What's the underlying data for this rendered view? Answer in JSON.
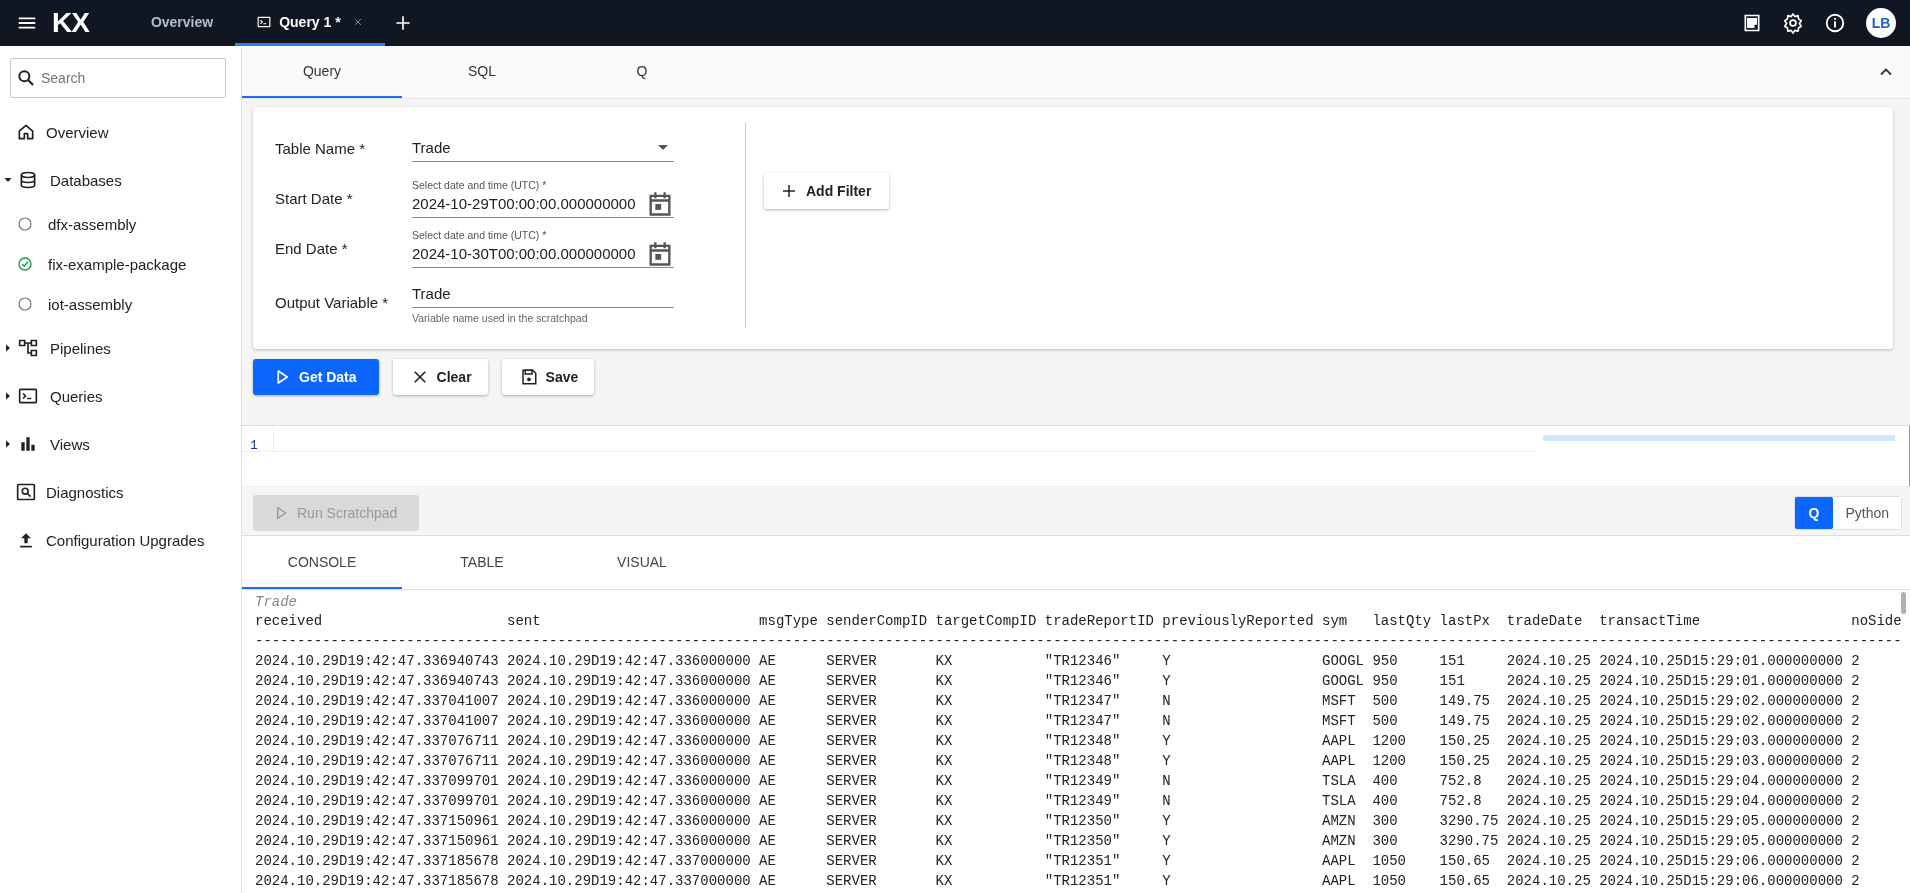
{
  "header": {
    "logo": "KX",
    "tabs": [
      {
        "label": "Overview",
        "selected": false
      },
      {
        "label": "Query 1 *",
        "selected": true
      }
    ],
    "avatar": "LB"
  },
  "sidebar": {
    "search": {
      "placeholder": "Search"
    },
    "items": [
      {
        "label": "Overview",
        "kind": "link"
      },
      {
        "label": "Databases",
        "kind": "group",
        "expanded": true,
        "children": [
          {
            "label": "dfx-assembly",
            "ready": false
          },
          {
            "label": "fix-example-package",
            "ready": true
          },
          {
            "label": "iot-assembly",
            "ready": false
          }
        ]
      },
      {
        "label": "Pipelines",
        "kind": "group",
        "expanded": false
      },
      {
        "label": "Queries",
        "kind": "group",
        "expanded": false
      },
      {
        "label": "Views",
        "kind": "group",
        "expanded": false
      },
      {
        "label": "Diagnostics",
        "kind": "link"
      },
      {
        "label": "Configuration Upgrades",
        "kind": "link"
      }
    ]
  },
  "query_tabs": [
    {
      "label": "Query",
      "selected": true
    },
    {
      "label": "SQL",
      "selected": false
    },
    {
      "label": "Q",
      "selected": false
    }
  ],
  "form": {
    "fields": [
      {
        "label": "Table Name *",
        "kind": "select",
        "value": "Trade"
      },
      {
        "label": "Start Date *",
        "kind": "datetime",
        "floating_label": "Select date and time (UTC) *",
        "value": "2024-10-29T00:00:00.000000000"
      },
      {
        "label": "End Date *",
        "kind": "datetime",
        "floating_label": "Select date and time (UTC) *",
        "value": "2024-10-30T00:00:00.000000000"
      },
      {
        "label": "Output Variable *",
        "kind": "text",
        "value": "Trade",
        "helper": "Variable name used in the scratchpad"
      }
    ],
    "add_filter": "Add Filter"
  },
  "actions": [
    {
      "label": "Get Data",
      "kind": "primary"
    },
    {
      "label": "Clear",
      "kind": "clear"
    },
    {
      "label": "Save",
      "kind": "save"
    }
  ],
  "scratchpad": {
    "line_numbers": [
      "1"
    ],
    "run_button": {
      "label": "Run Scratchpad",
      "disabled": true
    },
    "languages": [
      {
        "label": "Q",
        "selected": true
      },
      {
        "label": "Python",
        "selected": false
      }
    ]
  },
  "output_tabs": [
    {
      "label": "CONSOLE",
      "selected": true
    },
    {
      "label": "TABLE",
      "selected": false
    },
    {
      "label": "VISUAL",
      "selected": false
    }
  ],
  "console": {
    "title": "Trade",
    "lines": [
      "received                      sent                          msgType senderCompID targetCompID tradeReportID previouslyReported sym   lastQty lastPx  tradeDate  transactTime                  noSide",
      "----------------------------------------------------------------------------------------------------------------------------------------------------------------------------------------------------",
      "2024.10.29D19:42:47.336940743 2024.10.29D19:42:47.336000000 AE      SERVER       KX           \"TR12346\"     Y                  GOOGL 950     151     2024.10.25 2024.10.25D15:29:01.000000000 2",
      "2024.10.29D19:42:47.336940743 2024.10.29D19:42:47.336000000 AE      SERVER       KX           \"TR12346\"     Y                  GOOGL 950     151     2024.10.25 2024.10.25D15:29:01.000000000 2",
      "2024.10.29D19:42:47.337041007 2024.10.29D19:42:47.336000000 AE      SERVER       KX           \"TR12347\"     N                  MSFT  500     149.75  2024.10.25 2024.10.25D15:29:02.000000000 2",
      "2024.10.29D19:42:47.337041007 2024.10.29D19:42:47.336000000 AE      SERVER       KX           \"TR12347\"     N                  MSFT  500     149.75  2024.10.25 2024.10.25D15:29:02.000000000 2",
      "2024.10.29D19:42:47.337076711 2024.10.29D19:42:47.336000000 AE      SERVER       KX           \"TR12348\"     Y                  AAPL  1200    150.25  2024.10.25 2024.10.25D15:29:03.000000000 2",
      "2024.10.29D19:42:47.337076711 2024.10.29D19:42:47.336000000 AE      SERVER       KX           \"TR12348\"     Y                  AAPL  1200    150.25  2024.10.25 2024.10.25D15:29:03.000000000 2",
      "2024.10.29D19:42:47.337099701 2024.10.29D19:42:47.336000000 AE      SERVER       KX           \"TR12349\"     N                  TSLA  400     752.8   2024.10.25 2024.10.25D15:29:04.000000000 2",
      "2024.10.29D19:42:47.337099701 2024.10.29D19:42:47.336000000 AE      SERVER       KX           \"TR12349\"     N                  TSLA  400     752.8   2024.10.25 2024.10.25D15:29:04.000000000 2",
      "2024.10.29D19:42:47.337150961 2024.10.29D19:42:47.336000000 AE      SERVER       KX           \"TR12350\"     Y                  AMZN  300     3290.75 2024.10.25 2024.10.25D15:29:05.000000000 2",
      "2024.10.29D19:42:47.337150961 2024.10.29D19:42:47.336000000 AE      SERVER       KX           \"TR12350\"     Y                  AMZN  300     3290.75 2024.10.25 2024.10.25D15:29:05.000000000 2",
      "2024.10.29D19:42:47.337185678 2024.10.29D19:42:47.337000000 AE      SERVER       KX           \"TR12351\"     Y                  AAPL  1050    150.65  2024.10.25 2024.10.25D15:29:06.000000000 2",
      "2024.10.29D19:42:47.337185678 2024.10.29D19:42:47.337000000 AE      SERVER       KX           \"TR12351\"     Y                  AAPL  1050    150.65  2024.10.25 2024.10.25D15:29:06.000000000 2"
    ]
  }
}
